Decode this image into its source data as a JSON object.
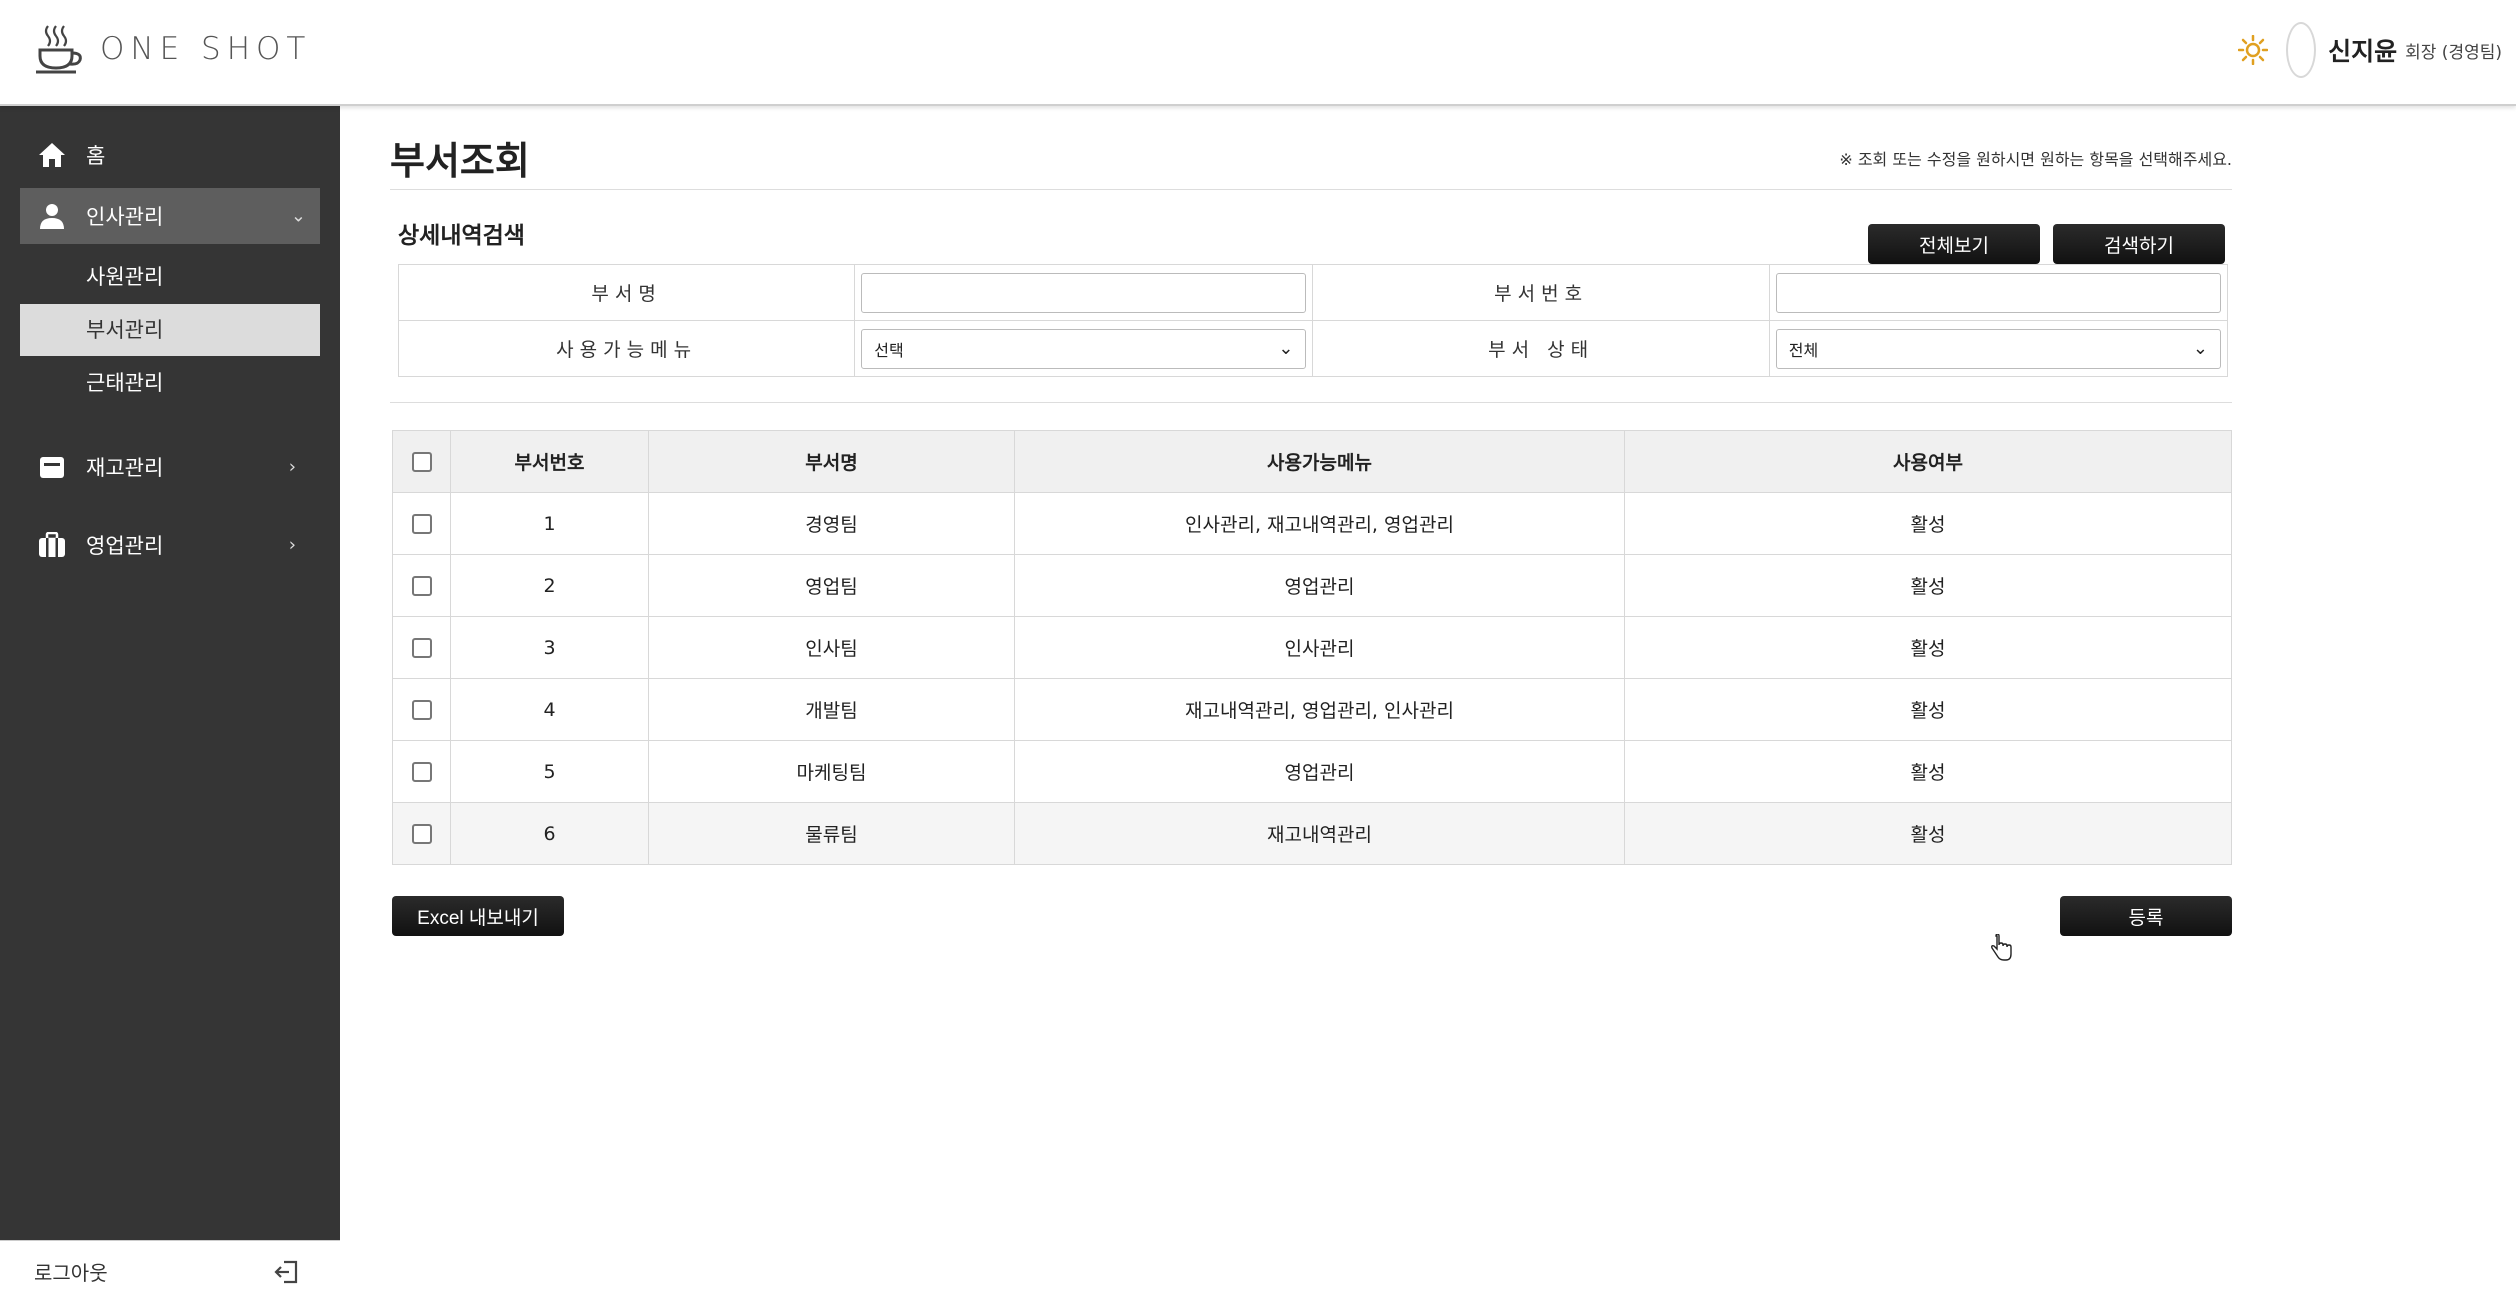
{
  "header": {
    "logo_text": "ONE SHOT",
    "user_name": "신지윤",
    "user_role": "회장 (경영팀)",
    "theme_icon": "sun-icon"
  },
  "sidebar": {
    "home": "홈",
    "items": [
      {
        "label": "인사관리",
        "icon": "person-icon",
        "open": true,
        "children": [
          "사원관리",
          "부서관리",
          "근태관리"
        ]
      },
      {
        "label": "재고관리",
        "icon": "box-icon"
      },
      {
        "label": "영업관리",
        "icon": "briefcase-icon"
      }
    ],
    "logout": "로그아웃"
  },
  "main": {
    "title": "부서조회",
    "notice": "※ 조회 또는 수정을 원하시면 원하는 항목을 선택해주세요.",
    "search": {
      "title": "상세내역검색",
      "btn_all": "전체보기",
      "btn_search": "검색하기",
      "label_name": "부서명",
      "label_no": "부서번호",
      "label_menu": "사용가능메뉴",
      "label_status": "부서 상태",
      "name_value": "",
      "no_value": "",
      "menu_selected": "선택",
      "status_selected": "전체"
    },
    "table": {
      "headers": [
        "부서번호",
        "부서명",
        "사용가능메뉴",
        "사용여부"
      ],
      "rows": [
        {
          "no": "1",
          "name": "경영팀",
          "menus": "인사관리, 재고내역관리, 영업관리",
          "status": "활성"
        },
        {
          "no": "2",
          "name": "영업팀",
          "menus": "영업관리",
          "status": "활성"
        },
        {
          "no": "3",
          "name": "인사팀",
          "menus": "인사관리",
          "status": "활성"
        },
        {
          "no": "4",
          "name": "개발팀",
          "menus": "재고내역관리, 영업관리, 인사관리",
          "status": "활성"
        },
        {
          "no": "5",
          "name": "마케팅팀",
          "menus": "영업관리",
          "status": "활성"
        },
        {
          "no": "6",
          "name": "물류팀",
          "menus": "재고내역관리",
          "status": "활성"
        }
      ]
    },
    "btn_excel": "Excel 내보내기",
    "btn_register": "등록"
  }
}
